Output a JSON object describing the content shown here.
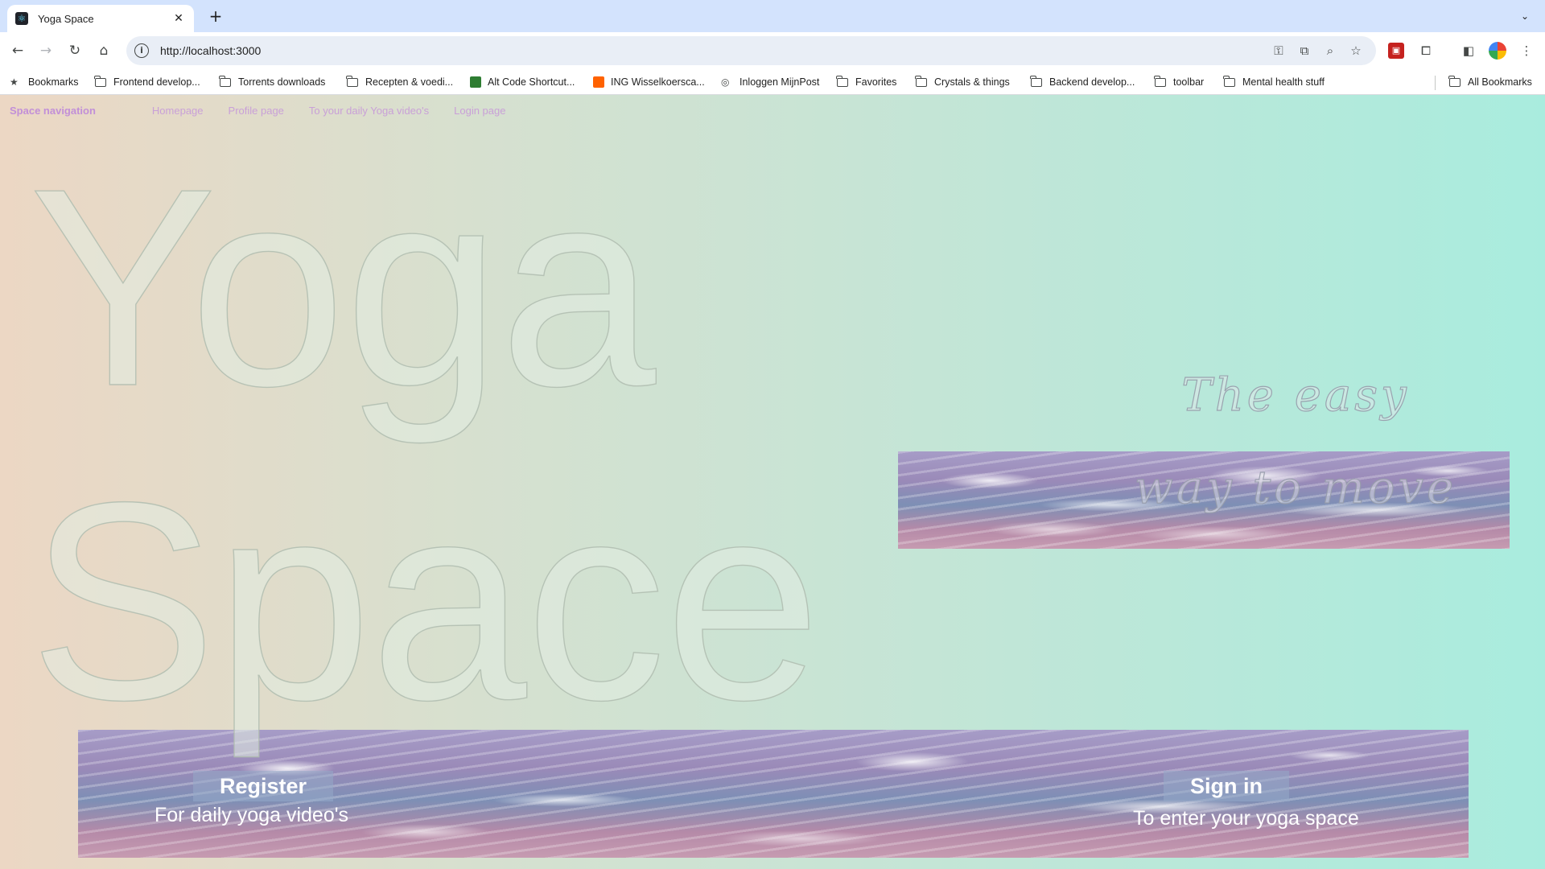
{
  "browser": {
    "tab_title": "Yoga Space",
    "tab_favicon": "react-icon",
    "new_tab_symbol": "+",
    "url": "http://localhost:3000",
    "bookmarks": [
      {
        "label": "Bookmarks",
        "icon": "star-icon"
      },
      {
        "label": "Frontend develop...",
        "icon": "folder-icon"
      },
      {
        "label": "Torrents downloads",
        "icon": "folder-icon"
      },
      {
        "label": "Recepten & voedi...",
        "icon": "folder-icon"
      },
      {
        "label": "Alt Code Shortcut...",
        "icon": "site-favicon"
      },
      {
        "label": "ING Wisselkoersca...",
        "icon": "site-favicon"
      },
      {
        "label": "Inloggen MijnPost",
        "icon": "globe-icon"
      },
      {
        "label": "Favorites",
        "icon": "folder-icon"
      },
      {
        "label": "Crystals & things",
        "icon": "folder-icon"
      },
      {
        "label": "Backend develop...",
        "icon": "folder-icon"
      },
      {
        "label": "toolbar",
        "icon": "folder-icon"
      },
      {
        "label": "Mental health stuff",
        "icon": "folder-icon"
      }
    ],
    "all_bookmarks": "All Bookmarks"
  },
  "site": {
    "nav": {
      "brand": "Space navigation",
      "links": [
        "Homepage",
        "Profile page",
        "To your daily Yoga video's",
        "Login page"
      ]
    },
    "hero_title": "Yoga Space",
    "tagline": "The easy way to move",
    "register": {
      "button": "Register",
      "subtitle": "For daily yoga video's"
    },
    "signin": {
      "button": "Sign in",
      "subtitle": "To enter your yoga space"
    }
  },
  "colors": {
    "gradient_left": "#ecd7c4",
    "gradient_right": "#a9ecde",
    "nav_text": "#c9a0d8",
    "tab_strip": "#d3e3fd"
  }
}
